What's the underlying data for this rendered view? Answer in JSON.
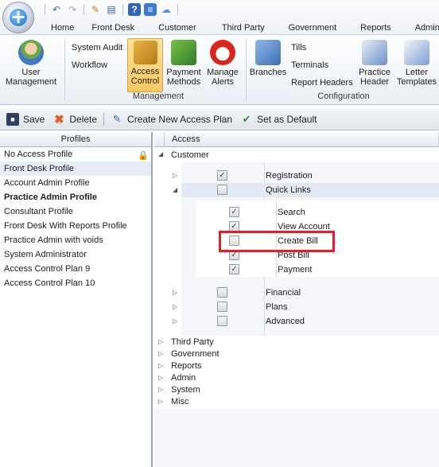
{
  "menu": {
    "tabs": [
      "Home",
      "Front Desk",
      "Customer",
      "Third Party",
      "Government",
      "Reports",
      "Admin"
    ]
  },
  "ribbon": {
    "user_management": "User\nManagement",
    "system_audit": "System Audit",
    "workflow": "Workflow",
    "access_control": "Access\nControl",
    "payment_methods": "Payment\nMethods",
    "manage_alerts": "Manage\nAlerts",
    "management_group": "Management",
    "branches": "Branches",
    "tills": "Tills",
    "terminals": "Terminals",
    "report_headers": "Report Headers",
    "practice_header": "Practice\nHeader",
    "letter_templates": "Letter\nTemplates",
    "configuration_group": "Configuration"
  },
  "toolbar": {
    "save": "Save",
    "delete": "Delete",
    "create_new": "Create New Access Plan",
    "set_default": "Set as Default"
  },
  "profiles": {
    "header": "Profiles",
    "items": [
      "No Access Profile",
      "Front Desk Profile",
      "Account Admin Profile",
      "Practice Admin Profile",
      "Consultant Profile",
      "Front Desk With Reports Profile",
      "Practice Admin with voids",
      "System Administrator",
      "Access Control Plan 9",
      "Access Control Plan 10"
    ]
  },
  "access": {
    "header": "Access",
    "customer": "Customer",
    "registration": "Registration",
    "quick_links": "Quick Links",
    "search": "Search",
    "view_account": "View Account",
    "create_bill": "Create Bill",
    "post_bill": "Post Bill",
    "payment": "Payment",
    "financial": "Financial",
    "plans": "Plans",
    "advanced": "Advanced",
    "third_party": "Third Party",
    "government": "Government",
    "reports": "Reports",
    "admin": "Admin",
    "system": "System",
    "misc": "Misc"
  },
  "colors": {
    "highlight_box": "#e2202a",
    "active_ribbon": "#f8c860",
    "selected_row": "#e6edf6"
  }
}
